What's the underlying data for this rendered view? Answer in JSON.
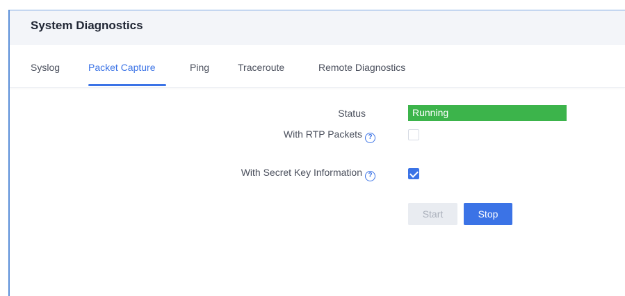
{
  "header": {
    "title": "System Diagnostics"
  },
  "tabs": [
    {
      "label": "Syslog",
      "active": false
    },
    {
      "label": "Packet Capture",
      "active": true
    },
    {
      "label": "Ping",
      "active": false
    },
    {
      "label": "Traceroute",
      "active": false
    },
    {
      "label": "Remote Diagnostics",
      "active": false
    }
  ],
  "form": {
    "status_label": "Status",
    "status_value": "Running",
    "rtp_label": "With RTP Packets",
    "rtp_checked": false,
    "secret_label": "With Secret Key Information",
    "secret_checked": true,
    "help_glyph": "?"
  },
  "buttons": {
    "start": "Start",
    "stop": "Stop"
  },
  "colors": {
    "accent": "#3b73e6",
    "status_running": "#3cb44b",
    "header_bg": "#f3f5f9"
  }
}
